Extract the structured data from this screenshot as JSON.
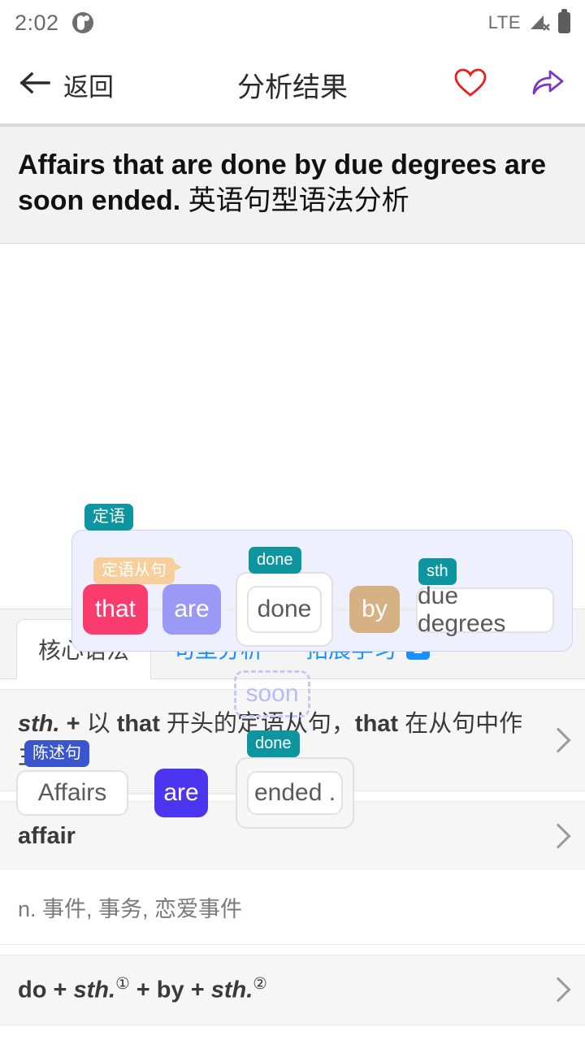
{
  "statusbar": {
    "time": "2:02",
    "network": "LTE",
    "app_icon": "app-circle-icon",
    "signal_icon": "signal-no-service-icon",
    "battery_icon": "battery-icon"
  },
  "appbar": {
    "back_label": "返回",
    "title": "分析结果",
    "favorite_icon": "heart-icon",
    "favorite_color": "#ee1c1c",
    "share_icon": "share-icon",
    "share_color": "#7b38c4"
  },
  "sentence": {
    "english": "Affairs that are done by due degrees are soon ended.",
    "chinese": "英语句型语法分析"
  },
  "diagram": {
    "clause_tag": "定语",
    "clause_type_tag": "定语从句",
    "statement_tag": "陈述句",
    "role_done_upper": "done",
    "role_sth": "sth",
    "role_done_lower": "done",
    "words": {
      "that": "that",
      "are_clause": "are",
      "done_inner": "done",
      "by": "by",
      "due_degrees": "due degrees",
      "affairs": "Affairs",
      "are_main": "are",
      "ended": "ended .",
      "soon": "soon"
    },
    "colors": {
      "pink": "#fa3d6e",
      "light_purple": "#9a9af6",
      "tan": "#d5b183",
      "blue": "#4b35ef",
      "teal": "#0d96a0",
      "orange": "#f8cf9b",
      "tag_blue": "#3a56cf",
      "clause_bg": "#eef1fd"
    }
  },
  "tabs": [
    {
      "label": "核心语法",
      "active": true,
      "badge": ""
    },
    {
      "label": "句型分析",
      "active": false,
      "badge": ""
    },
    {
      "label": "拓展学习",
      "active": false,
      "badge": "2"
    }
  ],
  "cards": [
    {
      "title_parts": [
        {
          "text": "sth.",
          "style": "italic-bold"
        },
        {
          "text": " + ",
          "style": "plus"
        },
        {
          "text": "以 ",
          "style": "normal"
        },
        {
          "text": "that",
          "style": "bold"
        },
        {
          "text": " 开头的定语从句，",
          "style": "normal"
        },
        {
          "text": "that",
          "style": "bold"
        },
        {
          "text": " 在从句中作主语",
          "style": "normal"
        }
      ],
      "title_plain": "sth. + 以 that 开头的定语从句，that 在从句中作主语",
      "body": ""
    },
    {
      "title_parts": [
        {
          "text": "affair",
          "style": "bold"
        }
      ],
      "title_plain": "affair",
      "body": "n. 事件, 事务, 恋爱事件"
    },
    {
      "title_parts": [
        {
          "text": "do",
          "style": "bold"
        },
        {
          "text": " + ",
          "style": "plus"
        },
        {
          "text": "sth.",
          "style": "italic-bold"
        },
        {
          "text": "①",
          "style": "sup"
        },
        {
          "text": " + ",
          "style": "plus"
        },
        {
          "text": "by",
          "style": "bold"
        },
        {
          "text": " + ",
          "style": "plus"
        },
        {
          "text": "sth.",
          "style": "italic-bold"
        },
        {
          "text": "②",
          "style": "sup"
        }
      ],
      "title_plain": "do + sth.① + by + sth.②",
      "body": ""
    }
  ]
}
